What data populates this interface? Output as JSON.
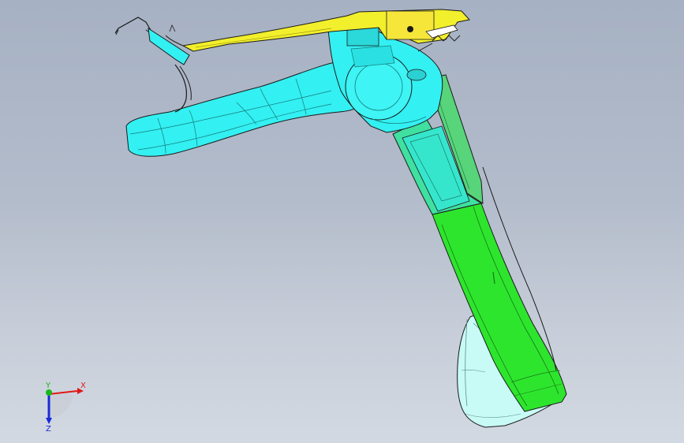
{
  "scene": {
    "part_colors": {
      "trigger_arm": "#f2ef2c",
      "handle_body": "#33f0f2",
      "grip_lower": "#2ee52e",
      "grip_upper": "#4bd98a",
      "rear_cover": "#c8fbf5",
      "background_top": "#a6b1c3",
      "background_bottom": "#d3d9e2",
      "edge": "#1a1a1a"
    }
  },
  "triad": {
    "x_label": "X",
    "y_label": "Y",
    "z_label": "Z",
    "x_color": "#e01818",
    "y_color": "#18b818",
    "z_color": "#1a2ad8"
  }
}
